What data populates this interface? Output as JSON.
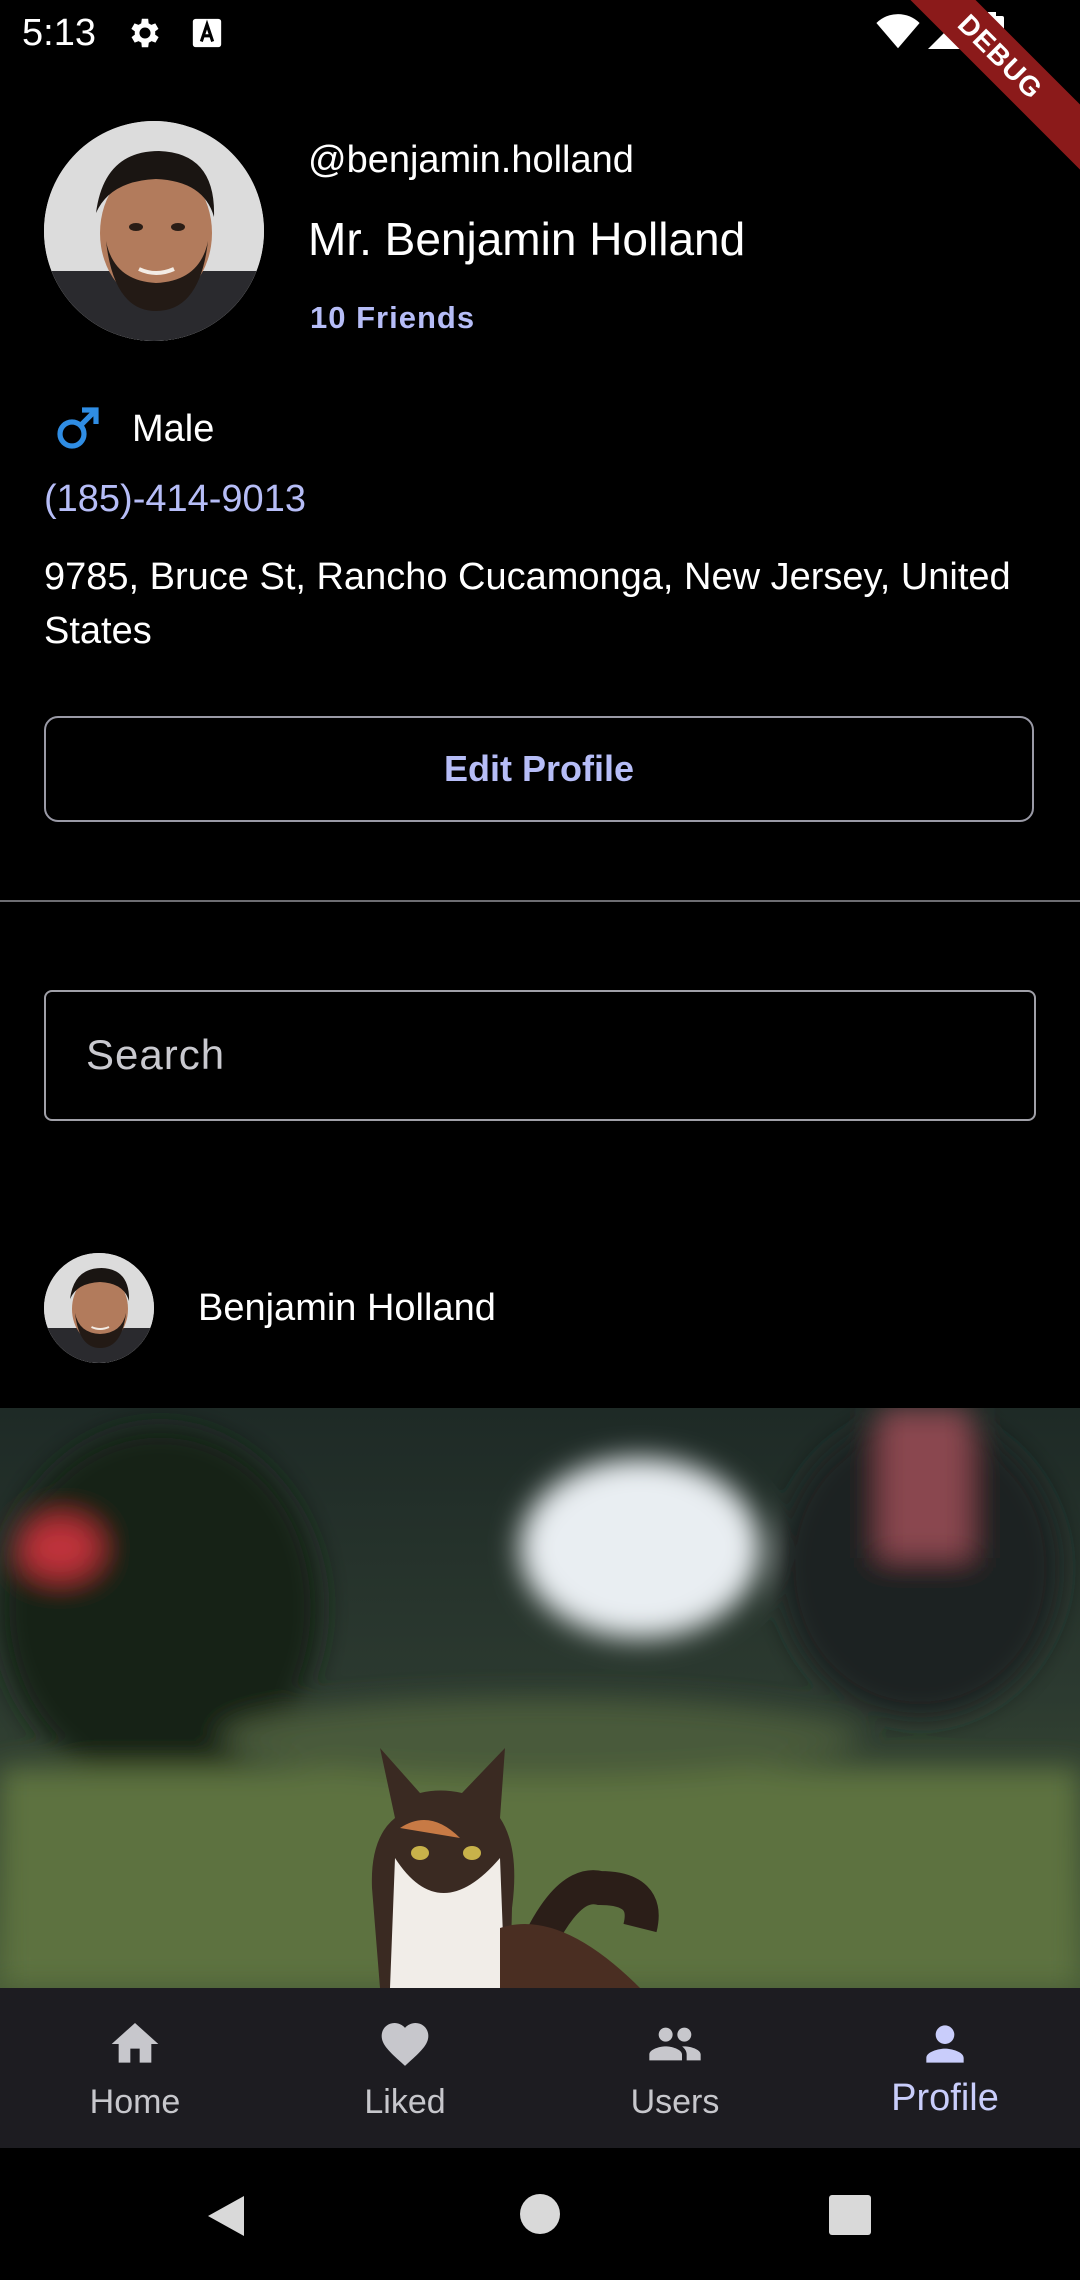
{
  "status_bar": {
    "time": "5:13",
    "debug_banner": "DEBUG",
    "icons": [
      "gear-icon",
      "font-a-icon",
      "wifi-icon",
      "signal-icon",
      "battery-icon"
    ]
  },
  "profile": {
    "username": "@benjamin.holland",
    "display_name": "Mr. Benjamin Holland",
    "friends": "10 Friends",
    "gender": "Male",
    "phone": "(185)-414-9013",
    "address": "9785, Bruce St, Rancho Cucamonga, New Jersey, United States",
    "edit_label": "Edit Profile"
  },
  "search": {
    "placeholder": "Search"
  },
  "post": {
    "author": "Benjamin Holland"
  },
  "bottom_nav": {
    "items": [
      {
        "label": "Home",
        "icon": "home-icon"
      },
      {
        "label": "Liked",
        "icon": "heart-icon"
      },
      {
        "label": "Users",
        "icon": "users-icon"
      },
      {
        "label": "Profile",
        "icon": "person-icon"
      }
    ],
    "active_index": 3
  },
  "colors": {
    "accent": "#b6bdf7",
    "male_icon": "#2f8de4",
    "background": "#000000",
    "nav_background": "#1d1c21",
    "debug_banner": "#8b1a1a"
  }
}
